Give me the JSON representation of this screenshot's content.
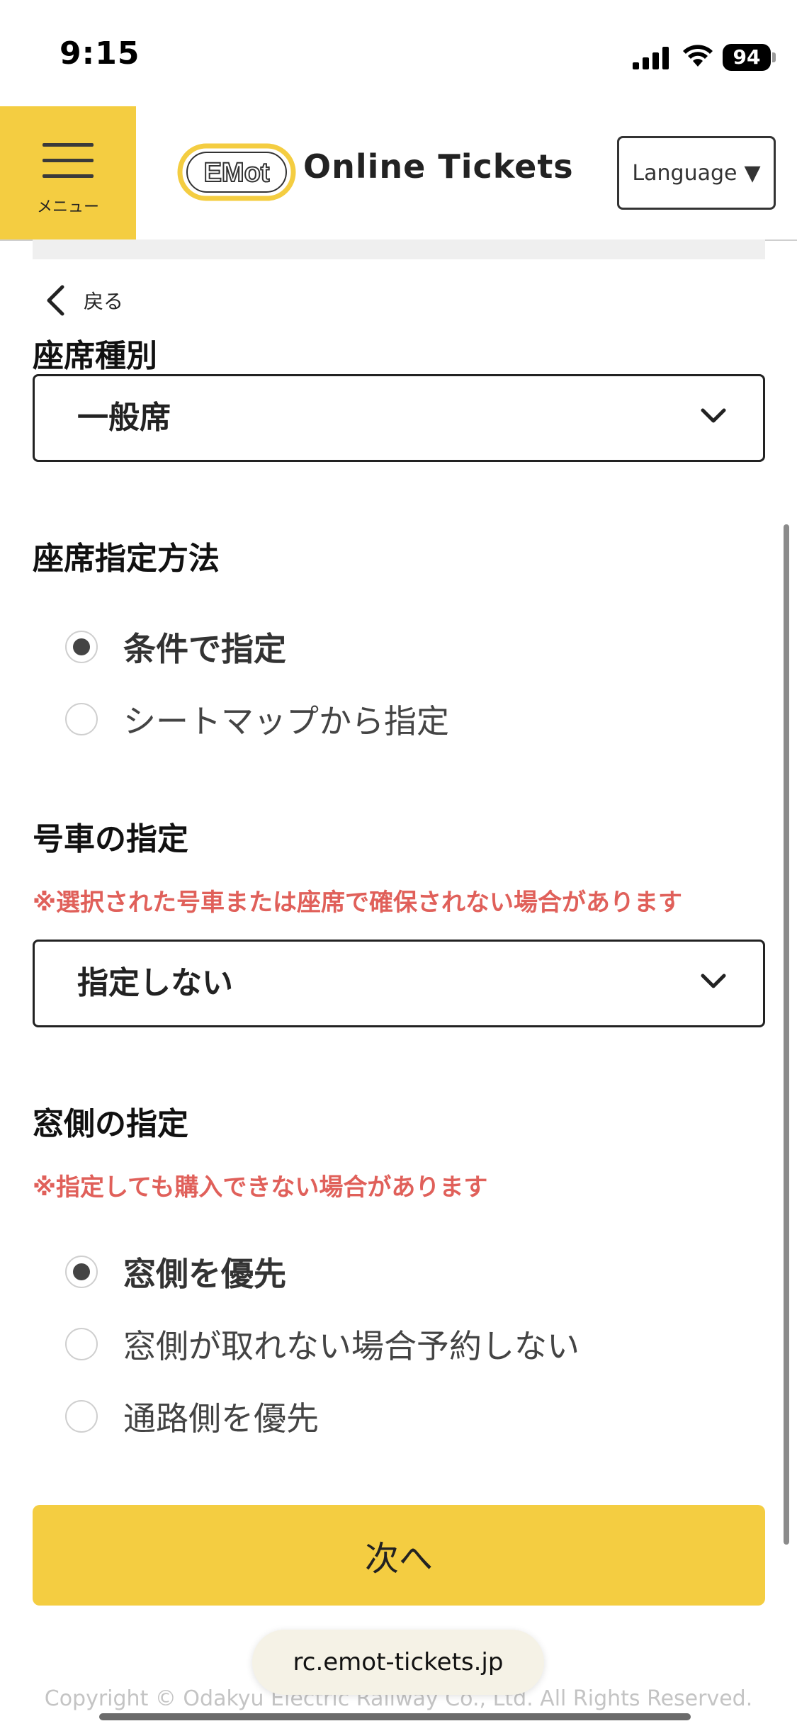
{
  "status_bar": {
    "time": "9:15",
    "battery": "94"
  },
  "header": {
    "menu_label": "メニュー",
    "logo_mark": "EMot",
    "title": "Online Tickets",
    "language_label": "Language",
    "language_arrow": "▼"
  },
  "back_label": "戻る",
  "seat_type": {
    "title": "座席種別",
    "value": "一般席"
  },
  "seat_method": {
    "title": "座席指定方法",
    "options": [
      {
        "label": "条件で指定",
        "selected": true
      },
      {
        "label": "シートマップから指定",
        "selected": false
      }
    ]
  },
  "car_number": {
    "title": "号車の指定",
    "warning": "※選択された号車または座席で確保されない場合があります",
    "value": "指定しない"
  },
  "window_side": {
    "title": "窓側の指定",
    "warning": "※指定しても購入できない場合があります",
    "options": [
      {
        "label": "窓側を優先",
        "selected": true
      },
      {
        "label": "窓側が取れない場合予約しない",
        "selected": false
      },
      {
        "label": "通路側を優先",
        "selected": false
      }
    ]
  },
  "next_label": "次へ",
  "url": "rc.emot-tickets.jp",
  "copyright": "Copyright © Odakyu Electric Railway Co., Ltd. All Rights Reserved.",
  "colors": {
    "accent": "#f4cd41",
    "warning": "#e0605a"
  },
  "icons": {
    "menu": "hamburger-icon",
    "back": "chevron-left-icon",
    "select": "chevron-down-icon",
    "signal": "signal-icon",
    "wifi": "wifi-icon"
  }
}
